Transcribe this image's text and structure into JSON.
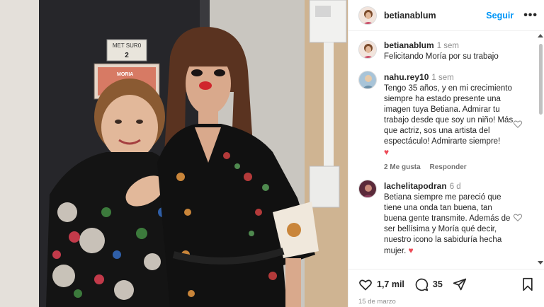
{
  "post": {
    "username": "betianablum",
    "follow_label": "Seguir",
    "more_label": "•••",
    "photo_sign": "MET SUR0",
    "photo_sign_number": "2",
    "photo_poster_text": "MORIA"
  },
  "caption": {
    "username": "betianablum",
    "time": "1 sem",
    "text": "Felicitando Moría por su trabajo"
  },
  "comments": [
    {
      "username": "nahu.rey10",
      "time": "1 sem",
      "text": "Tengo 35 años, y en mi crecimiento siempre ha estado presente una imagen tuya Betiana. Admirar tu trabajo desde que soy un niño! Más que actriz, sos una artista del espectáculo! Admirarte siempre!",
      "emoji": "♥",
      "likes_label": "2 Me gusta",
      "reply_label": "Responder"
    },
    {
      "username": "lachelitapodran",
      "time": "6 d",
      "text": "Betiana siempre me pareció que tiene una onda tan buena, tan buena gente transmite. Además de ser bellísima y Moría qué decir, nuestro icono la sabiduría hecha mujer.",
      "emoji": "♥"
    }
  ],
  "actions": {
    "likes_count": "1,7 mil",
    "comments_count": "35",
    "date": "15 de marzo"
  },
  "icons": {
    "like": "heart-icon",
    "comment": "comment-icon",
    "share": "share-icon",
    "save": "bookmark-icon",
    "more": "more-icon"
  },
  "colors": {
    "accent": "#0095f6",
    "heart": "#ed4956",
    "muted": "#8e8e8e"
  }
}
